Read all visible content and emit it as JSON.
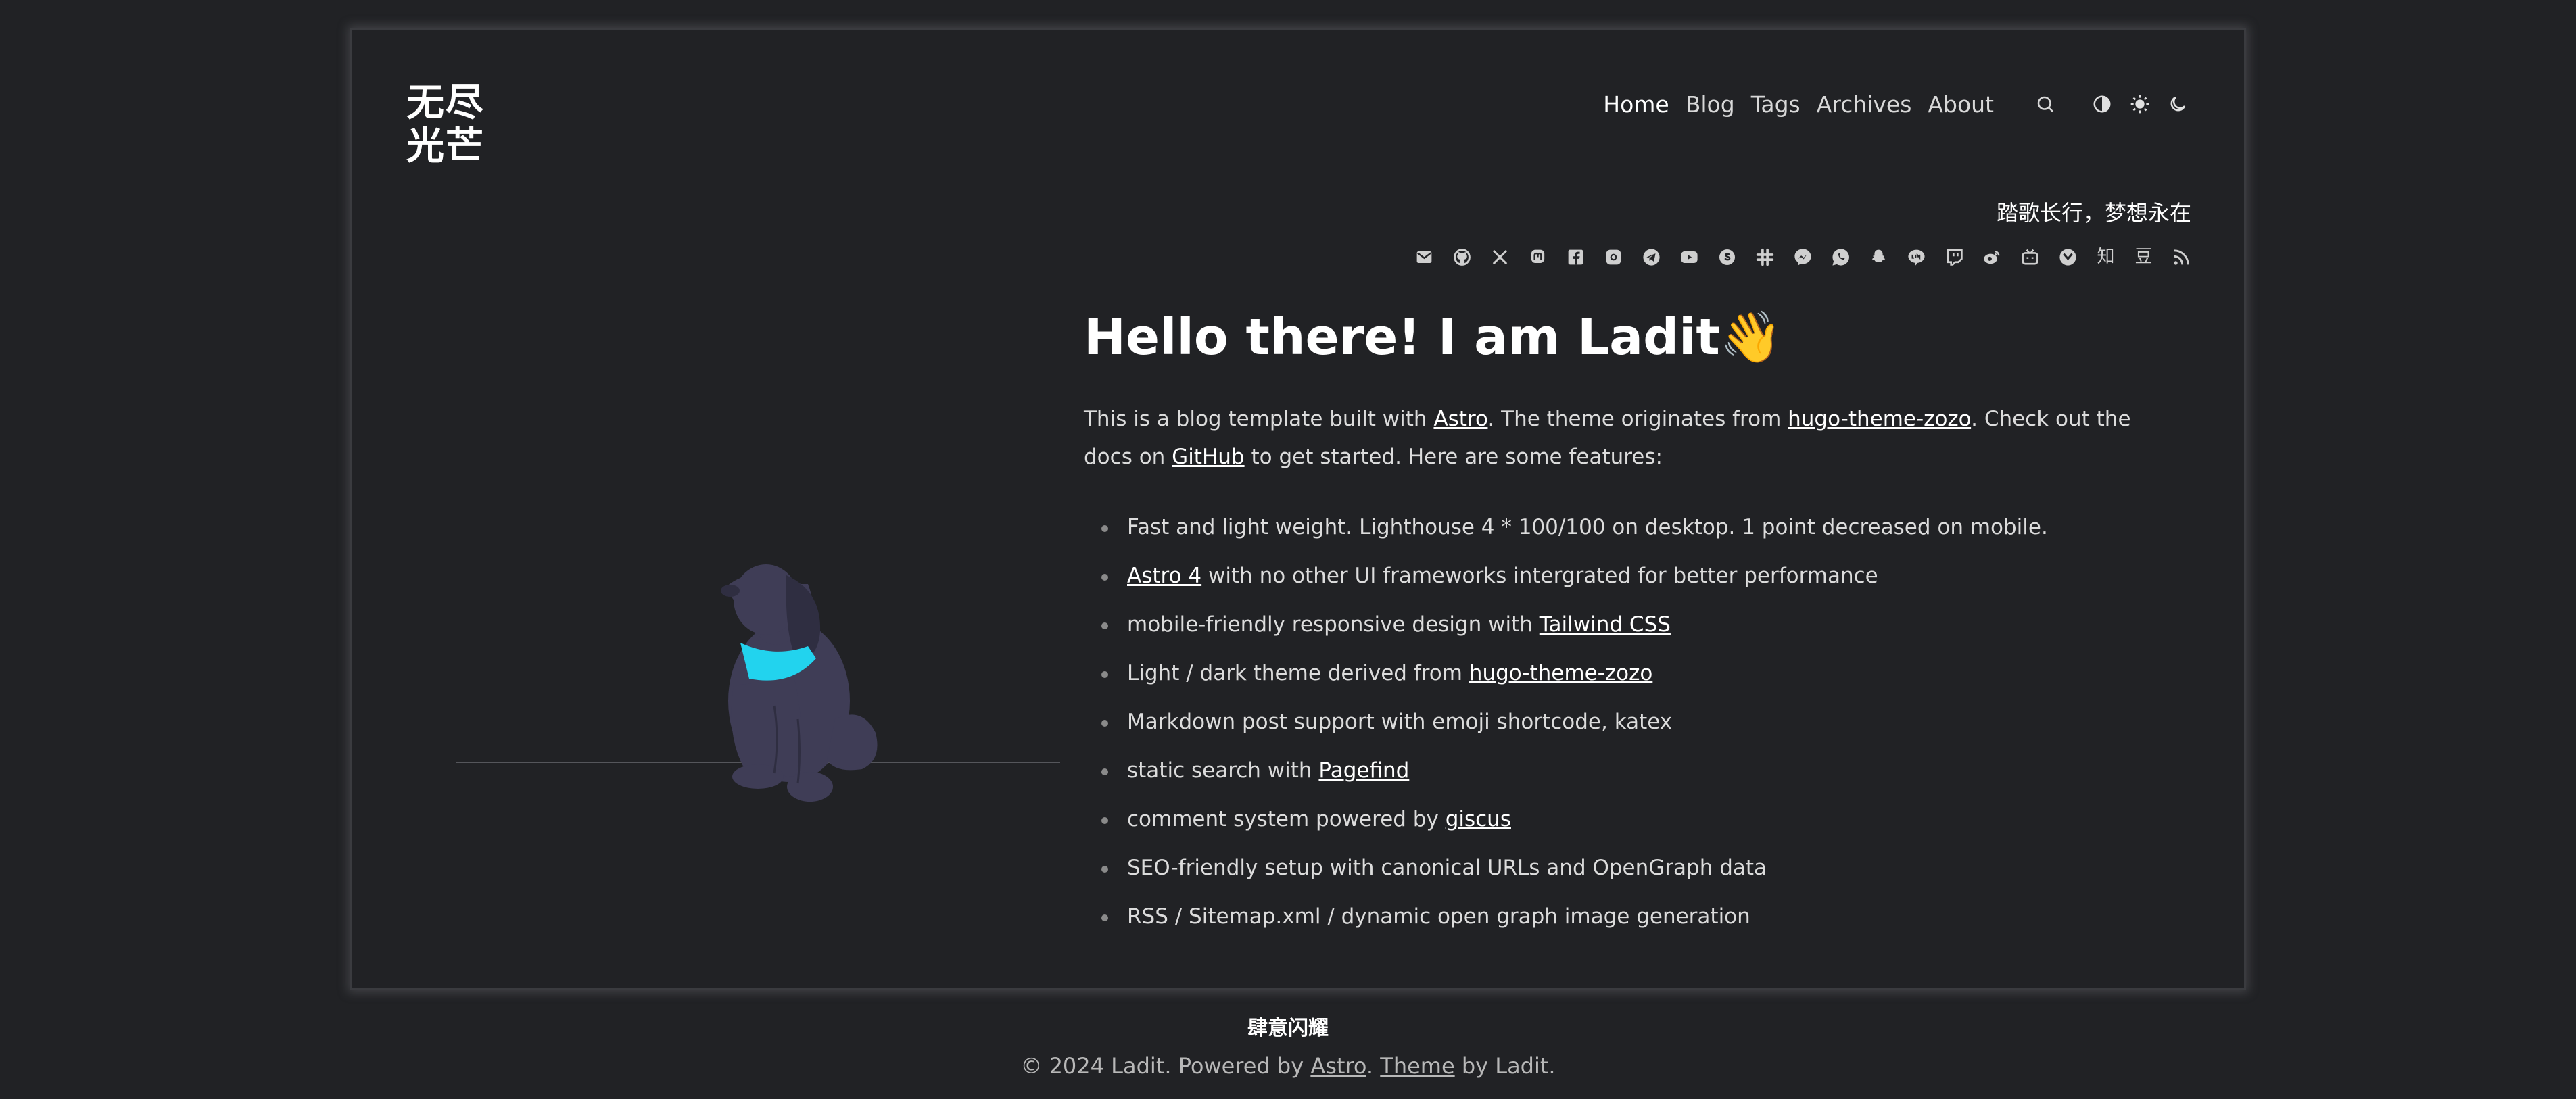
{
  "site": {
    "logo_line1": "无尽",
    "logo_line2": "光芒",
    "motto": "踏歌长行，梦想永在"
  },
  "nav": {
    "items": [
      {
        "label": "Home",
        "active": true
      },
      {
        "label": "Blog"
      },
      {
        "label": "Tags"
      },
      {
        "label": "Archives"
      },
      {
        "label": "About"
      }
    ],
    "icons": [
      "search-icon",
      "contrast-icon",
      "sun-icon",
      "moon-icon"
    ]
  },
  "socials": [
    "email",
    "github",
    "x",
    "mastodon",
    "facebook",
    "instagram",
    "telegram",
    "youtube",
    "skype",
    "slack",
    "messenger",
    "whatsapp",
    "snapchat",
    "line",
    "twitch",
    "weibo",
    "bilibili",
    "douban-circle",
    "zhihu",
    "douban",
    "rss"
  ],
  "socials_text": {
    "zhihu": "知",
    "douban": "豆"
  },
  "hero": {
    "title": "Hello there! I am Ladit",
    "emoji": "👋",
    "intro": {
      "t1": "This is a blog template built with ",
      "l1": "Astro",
      "t2": ". The theme originates from ",
      "l2": "hugo-theme-zozo",
      "t3": ". Check out the docs on ",
      "l3": "GitHub",
      "t4": " to get started. Here are some features:"
    }
  },
  "features": [
    {
      "text": "Fast and light weight. Lighthouse 4 * 100/100 on desktop. 1 point decreased on mobile."
    },
    {
      "link": "Astro 4",
      "after": " with no other UI frameworks intergrated for better performance"
    },
    {
      "before": "mobile-friendly responsive design with ",
      "link": "Tailwind CSS"
    },
    {
      "before": "Light / dark theme derived from ",
      "link": "hugo-theme-zozo"
    },
    {
      "text": "Markdown post support with emoji shortcode, katex"
    },
    {
      "before": "static search with ",
      "link": "Pagefind"
    },
    {
      "before": "comment system powered by ",
      "link": "giscus"
    },
    {
      "text": "SEO-friendly setup with canonical URLs and OpenGraph data"
    },
    {
      "text": "RSS / Sitemap.xml / dynamic open graph image generation"
    }
  ],
  "footer": {
    "title": "肆意闪耀",
    "copy_prefix": "© 2024 Ladit. Powered by ",
    "astro": "Astro",
    "sep": ". ",
    "theme": "Theme",
    "suffix": " by Ladit."
  },
  "colors": {
    "background": "#212225",
    "accent_collar": "#22d3ee",
    "dog": "#3f3d56"
  }
}
